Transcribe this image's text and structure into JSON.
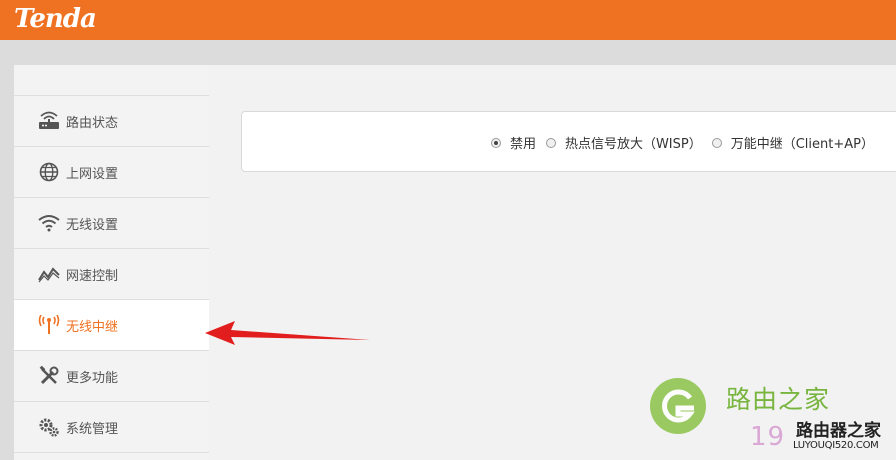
{
  "brand": {
    "logo_text": "Tenda",
    "accent": "#ef7122"
  },
  "sidebar": {
    "items": [
      {
        "label": "路由状态",
        "icon": "router-icon",
        "active": false
      },
      {
        "label": "上网设置",
        "icon": "globe-icon",
        "active": false
      },
      {
        "label": "无线设置",
        "icon": "wifi-icon",
        "active": false
      },
      {
        "label": "网速控制",
        "icon": "speed-chart-icon",
        "active": false
      },
      {
        "label": "无线中继",
        "icon": "antenna-icon",
        "active": true
      },
      {
        "label": "更多功能",
        "icon": "tools-icon",
        "active": false
      },
      {
        "label": "系统管理",
        "icon": "gears-icon",
        "active": false
      }
    ]
  },
  "main": {
    "repeater_mode": {
      "options": [
        {
          "label": "禁用",
          "selected": true
        },
        {
          "label": "热点信号放大（WISP）",
          "selected": false
        },
        {
          "label": "万能中继（Client+AP）",
          "selected": false
        }
      ]
    }
  },
  "watermark": {
    "title": "路由之家",
    "subtitle": "路由器之家",
    "url": "LUYOUQI520.COM",
    "number": "19"
  }
}
